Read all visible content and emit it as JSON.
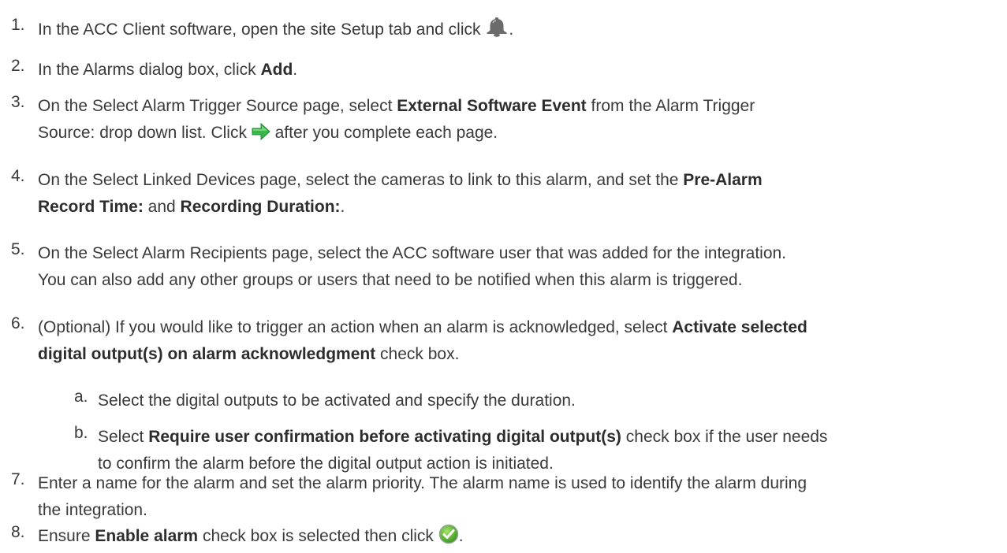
{
  "steps": [
    {
      "num": "1.",
      "parts": [
        "In the ACC Client software, open the site Setup tab and click ",
        "."
      ]
    },
    {
      "num": "2.",
      "parts": [
        "In the Alarms dialog box, click ",
        "Add",
        "."
      ]
    },
    {
      "num": "3.",
      "parts": [
        "On the Select Alarm Trigger Source page, select ",
        "External Software Event",
        " from the Alarm Trigger",
        "Source: drop down list. Click ",
        " after you complete each page."
      ]
    },
    {
      "num": "4.",
      "parts": [
        "On the Select Linked Devices page, select the cameras to link to this alarm, and set the ",
        "Pre-Alarm",
        "Record Time:",
        " and ",
        "Recording Duration:",
        "."
      ]
    },
    {
      "num": "5.",
      "parts": [
        "On the Select Alarm Recipients page, select the ACC software user that was added for the integration.",
        "You can also add any other groups or users that need to be notified when this alarm is triggered."
      ]
    },
    {
      "num": "6.",
      "parts": [
        "(Optional) If you would like to trigger an action when an alarm is acknowledged, select ",
        "Activate selected",
        "digital output(s) on alarm acknowledgment",
        " check box."
      ]
    },
    {
      "num": "a.",
      "parts": [
        "Select the digital outputs to be activated and specify the duration."
      ]
    },
    {
      "num": "b.",
      "parts": [
        "Select ",
        "Require user confirmation before activating digital output(s)",
        " check box if the user needs",
        "to confirm the alarm before the digital output action is initiated."
      ]
    },
    {
      "num": "7.",
      "parts": [
        "Enter a name for the alarm and set the alarm priority. The alarm name is used to identify the alarm during",
        "the integration."
      ]
    },
    {
      "num": "8.",
      "parts": [
        "Ensure ",
        "Enable alarm",
        " check box is selected then click ",
        "."
      ]
    }
  ],
  "icons": {
    "alarm": "bell-icon",
    "next": "green-arrow-icon",
    "finish": "checkmark-icon"
  }
}
